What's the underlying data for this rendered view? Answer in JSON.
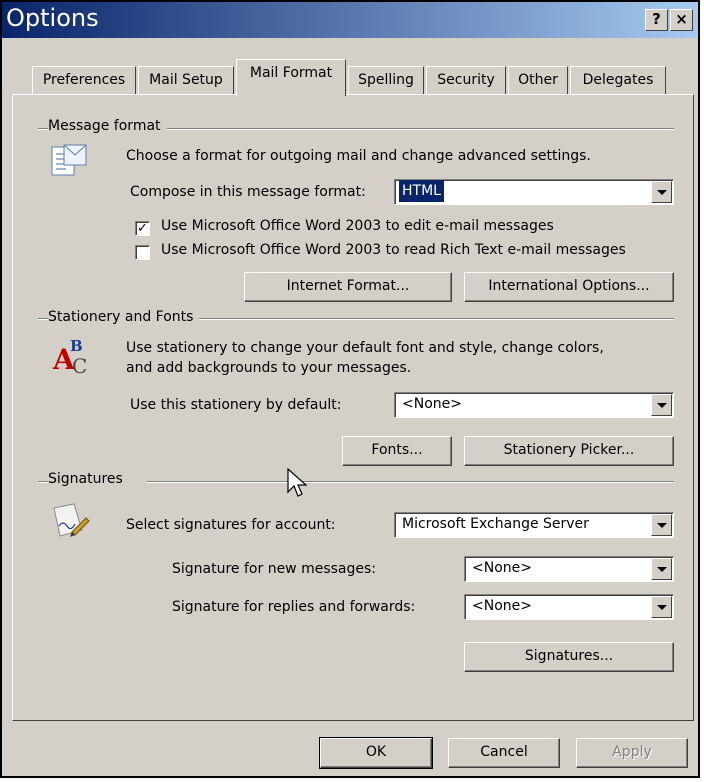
{
  "window": {
    "title": "Options",
    "help_glyph": "?",
    "close_glyph": "×"
  },
  "tabs": [
    "Preferences",
    "Mail Setup",
    "Mail Format",
    "Spelling",
    "Security",
    "Other",
    "Delegates"
  ],
  "message_format": {
    "heading": "Message format",
    "description": "Choose a format for outgoing mail and change advanced settings.",
    "compose_label": "Compose in this message format:",
    "compose_value": "HTML",
    "word_edit_label": "Use Microsoft Office Word 2003 to edit e-mail messages",
    "word_edit_checked": true,
    "word_read_label": "Use Microsoft Office Word 2003 to read Rich Text e-mail messages",
    "word_read_checked": false,
    "internet_format_button": "Internet Format...",
    "international_options_button": "International Options..."
  },
  "stationery": {
    "heading": "Stationery and Fonts",
    "description_line1": "Use stationery to change your default font and style, change colors,",
    "description_line2": "and add backgrounds to your messages.",
    "default_label": "Use this stationery by default:",
    "default_value": "<None>",
    "fonts_button": "Fonts...",
    "picker_button": "Stationery Picker..."
  },
  "signatures": {
    "heading": "Signatures",
    "account_label": "Select signatures for account:",
    "account_value": "Microsoft Exchange Server",
    "new_label": "Signature for new messages:",
    "new_value": "<None>",
    "replies_label": "Signature for replies and forwards:",
    "replies_value": "<None>",
    "signatures_button": "Signatures..."
  },
  "footer": {
    "ok": "OK",
    "cancel": "Cancel",
    "apply": "Apply"
  },
  "colors": {
    "titlebar_start": "#0a246a",
    "titlebar_end": "#a6caf0",
    "face": "#d4d0c8"
  }
}
